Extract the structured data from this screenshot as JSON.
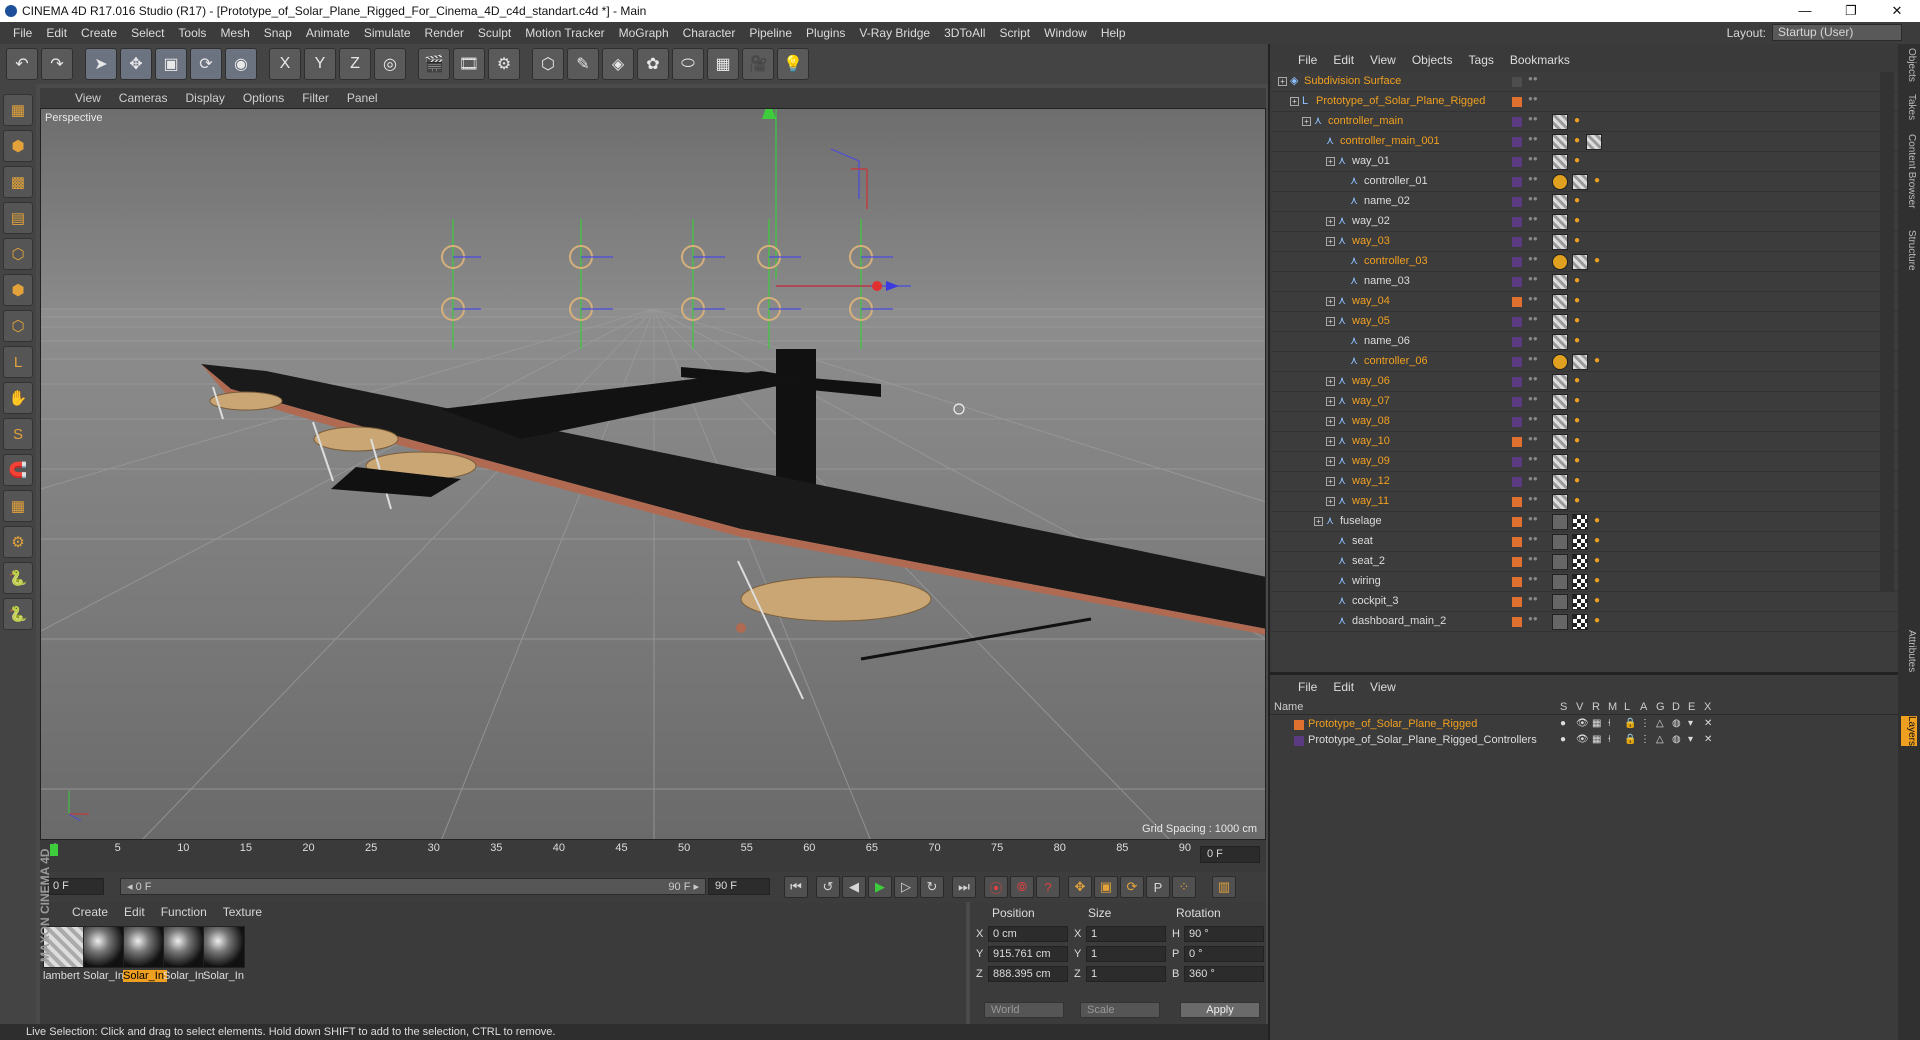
{
  "window": {
    "title": "CINEMA 4D R17.016 Studio (R17) - [Prototype_of_Solar_Plane_Rigged_For_Cinema_4D_c4d_standart.c4d *] - Main",
    "controls": [
      "—",
      "❐",
      "✕"
    ]
  },
  "menubar": {
    "items": [
      "File",
      "Edit",
      "Create",
      "Select",
      "Tools",
      "Mesh",
      "Snap",
      "Animate",
      "Simulate",
      "Render",
      "Sculpt",
      "Motion Tracker",
      "MoGraph",
      "Character",
      "Pipeline",
      "Plugins",
      "V-Ray Bridge",
      "3DToAll",
      "Script",
      "Window",
      "Help"
    ],
    "layout_label": "Layout:",
    "layout_value": "Startup (User)"
  },
  "toolbar": {
    "icons": [
      "undo-icon",
      "redo-icon",
      "live-selection-icon",
      "move-icon",
      "scale-icon",
      "rotate-icon",
      "recent-tool-icon",
      "x-axis-icon",
      "y-axis-icon",
      "z-axis-icon",
      "world-coordinates-icon",
      "render-view-icon",
      "render-picture-viewer-icon",
      "render-settings-icon",
      "cube-icon",
      "pen-icon",
      "subdivision-icon",
      "array-icon",
      "deformer-icon",
      "floor-icon",
      "camera-icon",
      "light-icon"
    ],
    "glyphs": [
      "↶",
      "↷",
      "➤",
      "✥",
      "▣",
      "⟳",
      "◉",
      "X",
      "Y",
      "Z",
      "◎",
      "🎬",
      "🎞",
      "⚙",
      "⬡",
      "✎",
      "◈",
      "✿",
      "⬭",
      "▦",
      "🎥",
      "💡"
    ]
  },
  "left_tools": {
    "glyphs": [
      "▦",
      "⬢",
      "▩",
      "▤",
      "⬡",
      "⬢",
      "⬡",
      "L",
      "✋",
      "S",
      "🧲",
      "▦",
      "⚙",
      "🐍",
      "🐍"
    ]
  },
  "viewport": {
    "menu": [
      "View",
      "Cameras",
      "Display",
      "Options",
      "Filter",
      "Panel"
    ],
    "label": "Perspective",
    "grid_spacing": "Grid Spacing : 1000 cm"
  },
  "timeline": {
    "ticks": [
      "0",
      "5",
      "10",
      "15",
      "20",
      "25",
      "30",
      "35",
      "40",
      "45",
      "50",
      "55",
      "60",
      "65",
      "70",
      "75",
      "80",
      "85",
      "90"
    ],
    "current_frame": "0 F",
    "start": "0 F",
    "range_start": "◂ 0 F",
    "range_end": "90 F ▸",
    "end": "90 F"
  },
  "materials": {
    "menu": [
      "Create",
      "Edit",
      "Function",
      "Texture"
    ],
    "items": [
      {
        "name": "lambert",
        "selected": false
      },
      {
        "name": "Solar_In",
        "selected": false
      },
      {
        "name": "Solar_In",
        "selected": true
      },
      {
        "name": "Solar_In",
        "selected": false
      },
      {
        "name": "Solar_In",
        "selected": false
      }
    ],
    "brand": "MAXON CINEMA 4D"
  },
  "coordinates": {
    "headers": [
      "Position",
      "Size",
      "Rotation"
    ],
    "rows": [
      {
        "axis": "X",
        "pos": "0 cm",
        "saxis": "X",
        "size": "1",
        "raxis": "H",
        "rot": "90 °"
      },
      {
        "axis": "Y",
        "pos": "915.761 cm",
        "saxis": "Y",
        "size": "1",
        "raxis": "P",
        "rot": "0 °"
      },
      {
        "axis": "Z",
        "pos": "888.395 cm",
        "saxis": "Z",
        "size": "1",
        "raxis": "B",
        "rot": "360 °"
      }
    ],
    "mode1": "World",
    "mode2": "Scale",
    "apply": "Apply"
  },
  "status": "Live Selection: Click and drag to select elements. Hold down SHIFT to add to the selection, CTRL to remove.",
  "objects": {
    "menu": [
      "File",
      "Edit",
      "View",
      "Objects",
      "Tags",
      "Bookmarks"
    ],
    "rows": [
      {
        "name": "Subdivision Surface",
        "depth": 0,
        "orange": true,
        "color": "#4d4d4d",
        "tags": []
      },
      {
        "name": "Prototype_of_Solar_Plane_Rigged",
        "depth": 1,
        "orange": true,
        "color": "#e07030",
        "tags": []
      },
      {
        "name": "controller_main",
        "depth": 2,
        "orange": true,
        "color": "#5a3a80",
        "tags": [
          "checker",
          "dot"
        ]
      },
      {
        "name": "controller_main_001",
        "depth": 3,
        "orange": true,
        "color": "#5a3a80",
        "tags": [
          "checker",
          "dot",
          "checker"
        ]
      },
      {
        "name": "way_01",
        "depth": 4,
        "orange": false,
        "color": "#5a3a80",
        "tags": [
          "checker",
          "dot"
        ]
      },
      {
        "name": "controller_01",
        "depth": 5,
        "orange": false,
        "color": "#5a3a80",
        "tags": [
          "forbid",
          "checker",
          "dot"
        ]
      },
      {
        "name": "name_02",
        "depth": 5,
        "orange": false,
        "color": "#5a3a80",
        "tags": [
          "checker",
          "dot"
        ]
      },
      {
        "name": "way_02",
        "depth": 4,
        "orange": false,
        "color": "#5a3a80",
        "tags": [
          "checker",
          "dot"
        ]
      },
      {
        "name": "way_03",
        "depth": 4,
        "orange": true,
        "color": "#5a3a80",
        "tags": [
          "checker",
          "dot"
        ]
      },
      {
        "name": "controller_03",
        "depth": 5,
        "orange": true,
        "color": "#5a3a80",
        "tags": [
          "forbid",
          "checker",
          "dot"
        ]
      },
      {
        "name": "name_03",
        "depth": 5,
        "orange": false,
        "color": "#5a3a80",
        "tags": [
          "checker",
          "dot"
        ]
      },
      {
        "name": "way_04",
        "depth": 4,
        "orange": true,
        "color": "#e07030",
        "tags": [
          "checker",
          "dot"
        ]
      },
      {
        "name": "way_05",
        "depth": 4,
        "orange": true,
        "color": "#5a3a80",
        "tags": [
          "checker",
          "dot"
        ]
      },
      {
        "name": "name_06",
        "depth": 5,
        "orange": false,
        "color": "#5a3a80",
        "tags": [
          "checker",
          "dot"
        ]
      },
      {
        "name": "controller_06",
        "depth": 5,
        "orange": true,
        "color": "#5a3a80",
        "tags": [
          "forbid",
          "checker",
          "dot"
        ]
      },
      {
        "name": "way_06",
        "depth": 4,
        "orange": true,
        "color": "#5a3a80",
        "tags": [
          "checker",
          "dot"
        ]
      },
      {
        "name": "way_07",
        "depth": 4,
        "orange": true,
        "color": "#5a3a80",
        "tags": [
          "checker",
          "dot"
        ]
      },
      {
        "name": "way_08",
        "depth": 4,
        "orange": true,
        "color": "#5a3a80",
        "tags": [
          "checker",
          "dot"
        ]
      },
      {
        "name": "way_10",
        "depth": 4,
        "orange": true,
        "color": "#e07030",
        "tags": [
          "checker",
          "dot"
        ]
      },
      {
        "name": "way_09",
        "depth": 4,
        "orange": true,
        "color": "#5a3a80",
        "tags": [
          "checker",
          "dot"
        ]
      },
      {
        "name": "way_12",
        "depth": 4,
        "orange": true,
        "color": "#5a3a80",
        "tags": [
          "checker",
          "dot"
        ]
      },
      {
        "name": "way_11",
        "depth": 4,
        "orange": true,
        "color": "#e07030",
        "tags": [
          "checker",
          "dot"
        ]
      },
      {
        "name": "fuselage",
        "depth": 3,
        "orange": false,
        "color": "#e07030",
        "tags": [
          "cube",
          "chk2",
          "dot"
        ]
      },
      {
        "name": "seat",
        "depth": 4,
        "orange": false,
        "color": "#e07030",
        "tags": [
          "cube",
          "chk2",
          "dot"
        ]
      },
      {
        "name": "seat_2",
        "depth": 4,
        "orange": false,
        "color": "#e07030",
        "tags": [
          "cube",
          "chk2",
          "dot"
        ]
      },
      {
        "name": "wiring",
        "depth": 4,
        "orange": false,
        "color": "#e07030",
        "tags": [
          "cube",
          "chk2",
          "dot"
        ]
      },
      {
        "name": "cockpit_3",
        "depth": 4,
        "orange": false,
        "color": "#e07030",
        "tags": [
          "cube",
          "chk2",
          "dot"
        ]
      },
      {
        "name": "dashboard_main_2",
        "depth": 4,
        "orange": false,
        "color": "#e07030",
        "tags": [
          "cube",
          "chk2",
          "dot"
        ]
      }
    ]
  },
  "layers": {
    "menu": [
      "File",
      "Edit",
      "View"
    ],
    "headers": [
      "Name",
      "S",
      "V",
      "R",
      "M",
      "L",
      "A",
      "G",
      "D",
      "E",
      "X"
    ],
    "rows": [
      {
        "name": "Prototype_of_Solar_Plane_Rigged",
        "orange": true,
        "color": "#e07030"
      },
      {
        "name": "Prototype_of_Solar_Plane_Rigged_Controllers",
        "orange": false,
        "color": "#5a3a80"
      }
    ]
  },
  "side_tabs": [
    "Objects",
    "Takes",
    "Content Browser",
    "Structure",
    "Attributes",
    "Layers"
  ]
}
